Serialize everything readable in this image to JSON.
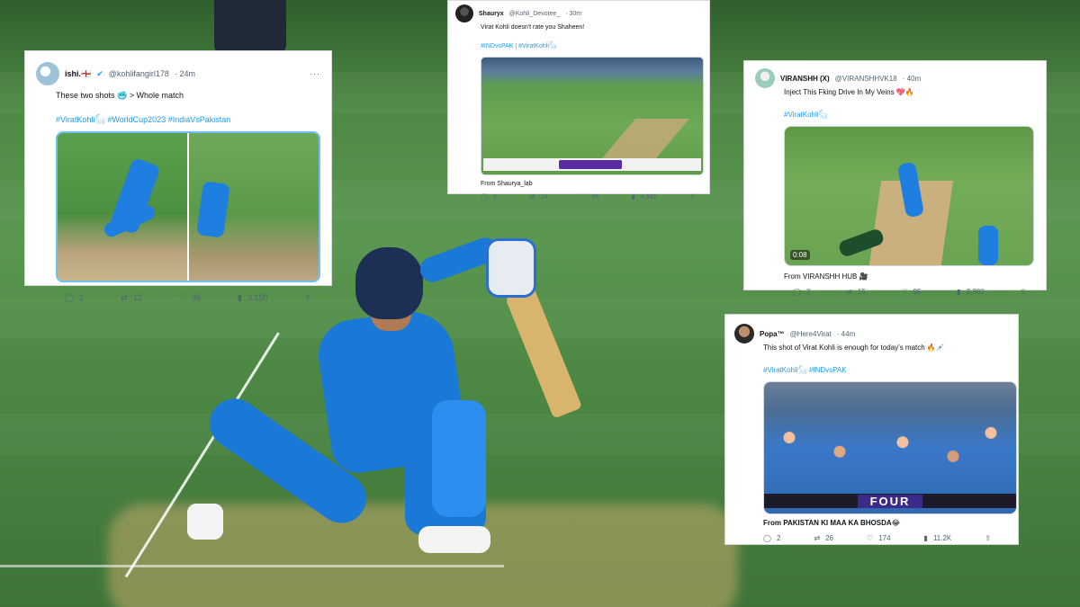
{
  "cards": [
    {
      "name": "ishi.🏴󠁧󠁢󠁥󠁮󠁧󠁿",
      "handle": "@kohlifangirl178",
      "time": "· 24m",
      "text": "These two shots 🥶 > Whole match",
      "tags": "#ViratKohli𓃵 #WorldCup2023 #IndiaVsPakistan",
      "stats": {
        "replies": "1",
        "retweets": "12",
        "likes": "98",
        "views": "3,150"
      }
    },
    {
      "name": "Shauryx",
      "handle": "@Kohli_Devotee_",
      "time": "· 30m",
      "text": "Virat Kohli doesn't rate you Shaheen!",
      "tags": "#INDvsPAK | #ViratKohli𓃵",
      "from": "From Shaurya_lab",
      "stats": {
        "replies": "2",
        "retweets": "24",
        "likes": "95",
        "views": "4,342"
      }
    },
    {
      "name": "VIRANSHH (X)",
      "handle": "@VIRANSHHVK18",
      "time": "· 40m",
      "text": "Inject This Fking Drive In My Veins 💖🔥",
      "tags": "#ViratKohli𓃵",
      "media_time": "0:08",
      "from": "From VIRANSHH HUB 🎥",
      "stats": {
        "replies": "2",
        "retweets": "15",
        "likes": "95",
        "views": "2,380"
      }
    },
    {
      "name": "Popa™",
      "handle": "@Here4Virat",
      "time": "· 44m",
      "text": "This shot of Virat Kohli is enough for today's match 🔥💉",
      "tags": "#ViratKohli𓃵 #INDvsPAK",
      "media_label": "FOUR",
      "from": "From PAKISTAN KI MAA KA BHOSDA😂",
      "stats": {
        "replies": "2",
        "retweets": "26",
        "likes": "174",
        "views": "11.2K"
      }
    }
  ],
  "icons": {
    "reply": "reply-icon",
    "retweet": "retweet-icon",
    "like": "heart-icon",
    "views": "views-icon",
    "share": "share-icon",
    "more": "more-icon"
  },
  "colors": {
    "link": "#1d9bf0",
    "muted": "#536471",
    "india_blue": "#1a78d6"
  }
}
